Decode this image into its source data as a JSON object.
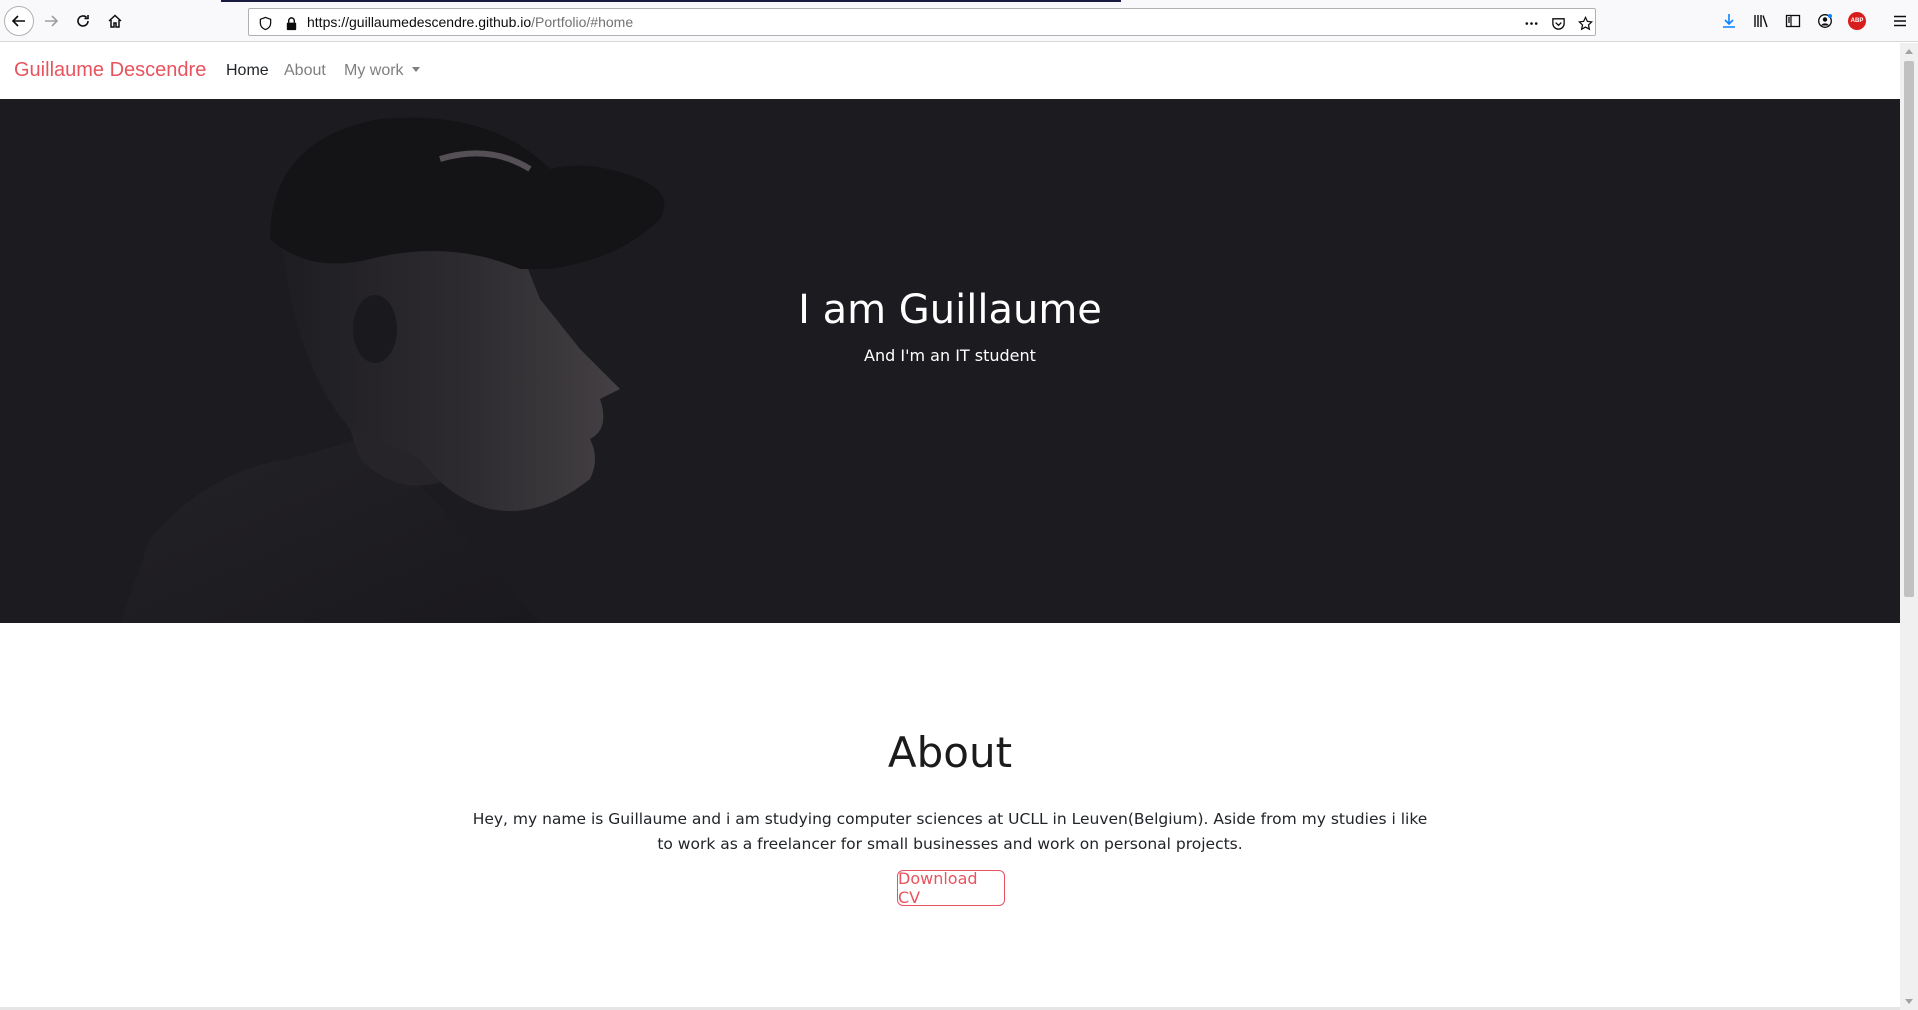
{
  "browser": {
    "url_host": "https://guillaumedescendre.github.io",
    "url_path": "/Portfolio/#home",
    "icons": [
      "back-icon",
      "forward-icon",
      "reload-icon",
      "home-icon",
      "tracking-shield-icon",
      "lock-icon",
      "more-actions-icon",
      "pocket-icon",
      "bookmark-star-icon",
      "download-icon",
      "library-icon",
      "sidebar-icon",
      "account-icon",
      "adblock-icon",
      "menu-icon"
    ],
    "adblock_label": "ABP"
  },
  "nav": {
    "brand": "Guillaume Descendre",
    "links": [
      "Home",
      "About",
      "My work"
    ]
  },
  "hero": {
    "title": "I am Guillaume",
    "subtitle": "And I'm an IT student"
  },
  "about": {
    "title": "About",
    "text": "Hey, my name is Guillaume and i am studying computer sciences at UCLL in Leuven(Belgium). Aside from my studies i like to work as a freelancer for small businesses and work on personal projects.",
    "button": "Download CV"
  },
  "colors": {
    "accent": "#e8535e",
    "hero_bg": "#1c1b1f"
  }
}
